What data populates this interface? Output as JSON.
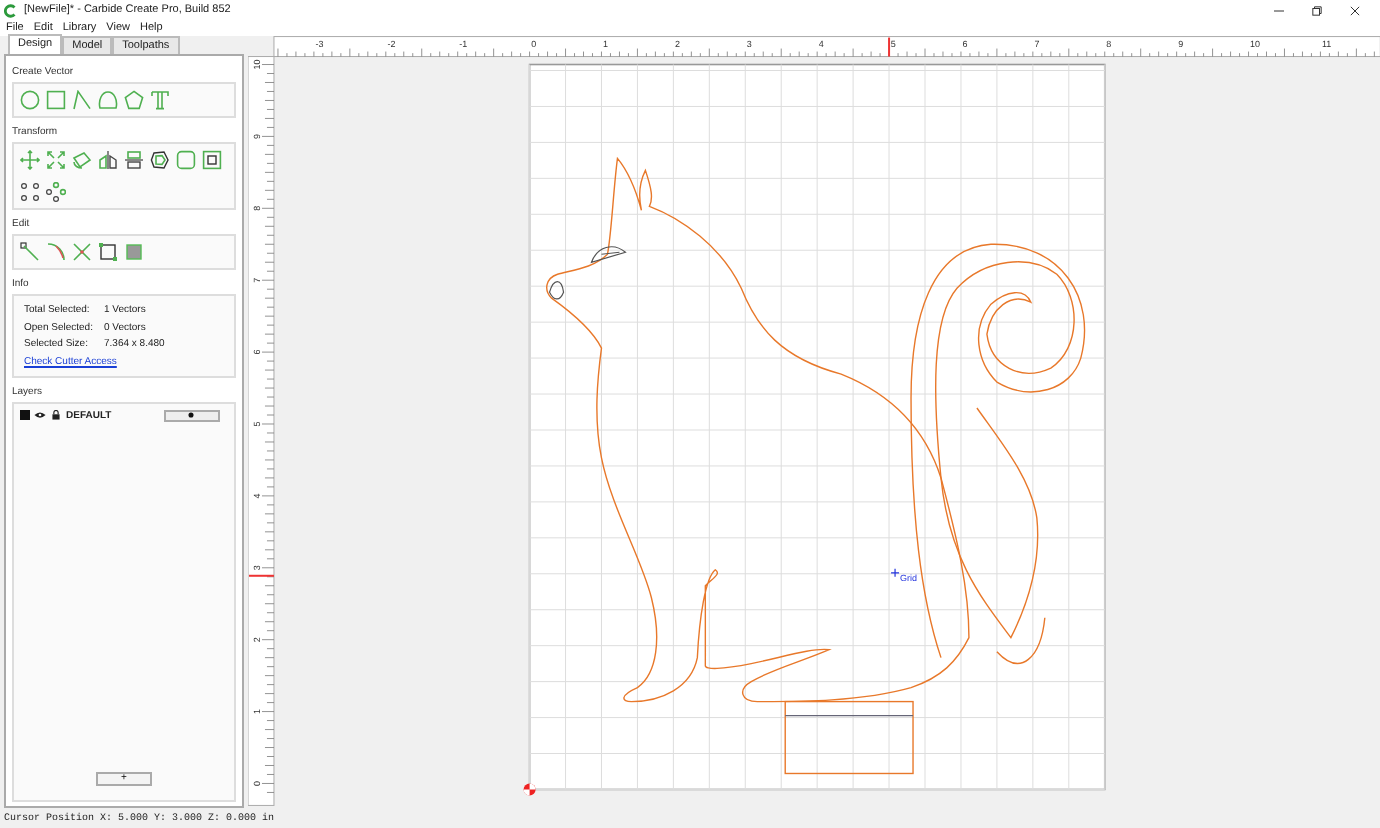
{
  "window": {
    "title": "[NewFile]* - Carbide Create Pro, Build 852"
  },
  "menu": [
    "File",
    "Edit",
    "Library",
    "View",
    "Help"
  ],
  "tabs": [
    {
      "label": "Design",
      "selected": true
    },
    {
      "label": "Model",
      "selected": false
    },
    {
      "label": "Toolpaths",
      "selected": false
    }
  ],
  "panel": {
    "create_vector_title": "Create Vector",
    "transform_title": "Transform",
    "edit_title": "Edit",
    "info_title": "Info",
    "info_rows": [
      {
        "label": "Total Selected:",
        "value": "1 Vectors"
      },
      {
        "label": "Open Selected:",
        "value": "0 Vectors"
      },
      {
        "label": "Selected Size:",
        "value": "7.364 x 8.480"
      }
    ],
    "link": "Check Cutter Access",
    "layers_title": "Layers",
    "layers": [
      {
        "name": "DEFAULT"
      }
    ],
    "add_button": "+"
  },
  "canvas": {
    "x_ticks": [
      "-3",
      "-2",
      "-1",
      "0",
      "1",
      "2",
      "3",
      "4",
      "5",
      "6",
      "7",
      "8",
      "9",
      "10",
      "11"
    ],
    "y_ticks": [
      "10",
      "9",
      "8",
      "7",
      "6",
      "5",
      "4",
      "3",
      "2",
      "1",
      "0"
    ],
    "grid_label": "Grid"
  },
  "status_bar": "Cursor Position X: 5.000 Y: 3.000 Z: 0.000 in"
}
